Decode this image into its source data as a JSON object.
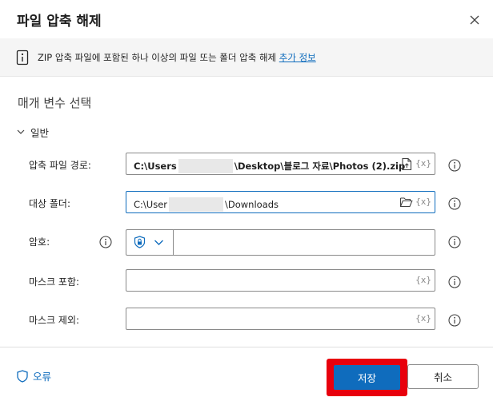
{
  "dialog": {
    "title": "파일 압축 해제"
  },
  "info": {
    "text": "ZIP 압축 파일에 포함된 하나 이상의 파일 또는 폴더 압축 해제 ",
    "link": "추가 정보"
  },
  "section": {
    "title": "매개 변수 선택"
  },
  "group": {
    "label": "일반"
  },
  "fields": {
    "archive_path": {
      "label": "압축 파일 경로:",
      "value_prefix": "C:\\Users",
      "value_suffix": "\\Desktop\\블로그 자료\\Photos (2).zip",
      "var": "{x}"
    },
    "destination": {
      "label": "대상 폴더:",
      "value_prefix": "C:\\User",
      "value_suffix": "\\Downloads",
      "var": "{x}"
    },
    "password": {
      "label": "암호:"
    },
    "include_mask": {
      "label": "마스크 포함:",
      "var": "{x}"
    },
    "exclude_mask": {
      "label": "마스크 제외:",
      "var": "{x}"
    }
  },
  "footer": {
    "error_label": "오류",
    "save_label": "저장",
    "cancel_label": "취소"
  },
  "colors": {
    "accent": "#0f6cbd",
    "highlight": "#e8000d"
  },
  "icons": [
    "close-icon",
    "info-icon",
    "chevron-down-icon",
    "file-icon",
    "folder-icon",
    "help-icon",
    "shield-icon",
    "variable-icon"
  ]
}
